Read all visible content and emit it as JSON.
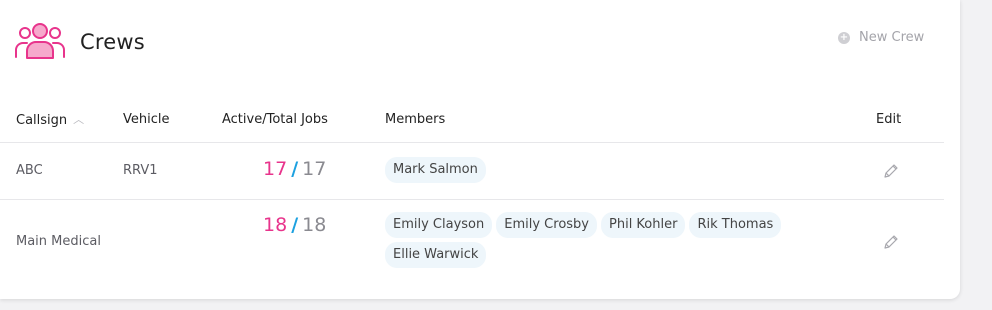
{
  "header": {
    "title": "Crews",
    "new_crew_label": "New Crew",
    "icon": "crews-icon"
  },
  "table": {
    "columns": [
      "Callsign",
      "Vehicle",
      "Active/Total Jobs",
      "Members",
      "Edit"
    ],
    "sorted_column": "Callsign",
    "rows": [
      {
        "callsign": "ABC",
        "vehicle": "RRV1",
        "active_jobs": "17",
        "separator": "/",
        "total_jobs": "17",
        "members": [
          "Mark Salmon"
        ]
      },
      {
        "callsign": "Main Medical",
        "vehicle": "",
        "active_jobs": "18",
        "separator": "/",
        "total_jobs": "18",
        "members": [
          "Emily Clayson",
          "Emily Crosby",
          "Phil Kohler",
          "Rik Thomas",
          "Ellie Warwick"
        ]
      }
    ]
  },
  "colors": {
    "accent": "#e8348c",
    "slash": "#1da1e0",
    "chip_bg": "#eef6fb"
  }
}
